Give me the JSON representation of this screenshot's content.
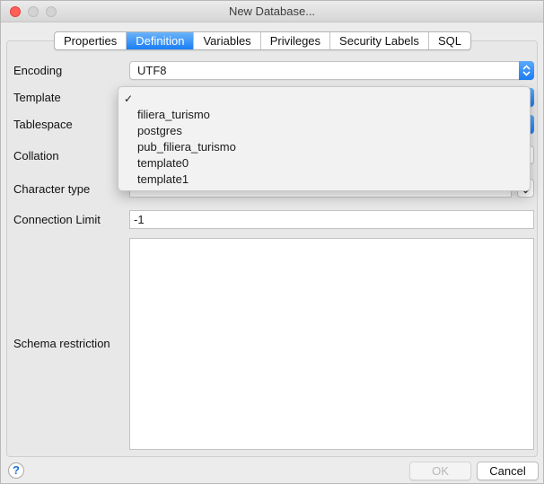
{
  "window": {
    "title": "New Database..."
  },
  "tabs": [
    {
      "label": "Properties"
    },
    {
      "label": "Definition"
    },
    {
      "label": "Variables"
    },
    {
      "label": "Privileges"
    },
    {
      "label": "Security Labels"
    },
    {
      "label": "SQL"
    }
  ],
  "active_tab": "Definition",
  "form": {
    "encoding": {
      "label": "Encoding",
      "value": "UTF8"
    },
    "template": {
      "label": "Template",
      "value": ""
    },
    "tablespace": {
      "label": "Tablespace",
      "value": ""
    },
    "collation": {
      "label": "Collation",
      "value": ""
    },
    "character_type": {
      "label": "Character type",
      "value": ""
    },
    "connection_limit": {
      "label": "Connection Limit",
      "value": "-1"
    },
    "schema_restriction": {
      "label": "Schema restriction",
      "value": ""
    }
  },
  "template_menu": {
    "check": "✓",
    "items": [
      "",
      "filiera_turismo",
      "postgres",
      "pub_filiera_turismo",
      "template0",
      "template1"
    ]
  },
  "footer": {
    "help_label": "?",
    "ok_label": "OK",
    "cancel_label": "Cancel"
  },
  "colors": {
    "accent": "#1a7ef5",
    "close": "#ff5f57"
  }
}
